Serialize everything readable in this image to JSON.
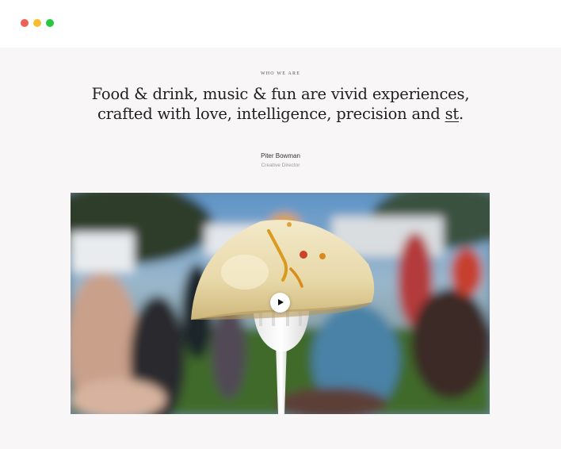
{
  "window": {
    "controls": [
      {
        "name": "close",
        "color": "#ee5f57"
      },
      {
        "name": "minimize",
        "color": "#f5bd2f"
      },
      {
        "name": "maximize",
        "color": "#29c740"
      }
    ]
  },
  "hero": {
    "eyebrow": "WHO WE ARE",
    "headline_text": "Food & drink, music & fun are vivid experiences, crafted with love, intelligence, precision and ",
    "headline_typed": "st",
    "headline_end": ".",
    "author_name": "Piter Bowman",
    "author_role": "Creative Director"
  },
  "media": {
    "image_description_icon": "dumpling-on-fork-photo",
    "play_icon": "play-icon"
  },
  "colors": {
    "page_background": "#f8f6f6",
    "heading": "#1f1f22",
    "muted": "#9a9a9a"
  }
}
